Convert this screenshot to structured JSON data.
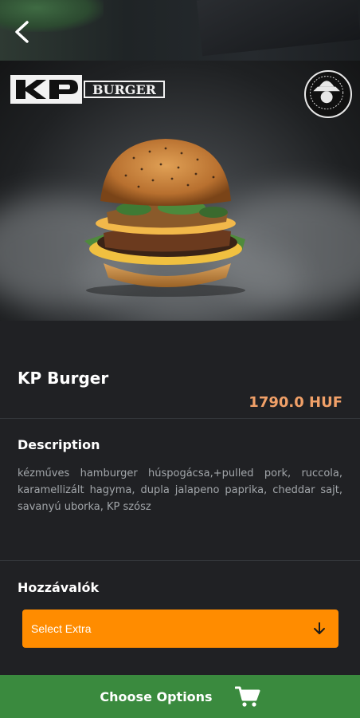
{
  "product": {
    "title": "KP Burger",
    "price": "1790.0 HUF"
  },
  "logo": {
    "brand_text": "BURGER"
  },
  "description": {
    "heading": "Description",
    "text": "kézműves hamburger húspogácsa,+pulled pork, ruccola, karamellizált hagyma, dupla jalapeno paprika, cheddar sajt, savanyú uborka, KP szósz"
  },
  "ingredients": {
    "heading": "Hozzávalók",
    "select_label": "Select Extra"
  },
  "footer": {
    "button_label": "Choose Options"
  },
  "icons": {
    "back": "back-arrow-icon",
    "dropdown": "arrow-down-icon",
    "cart": "cart-icon"
  },
  "colors": {
    "background": "#202124",
    "price": "#f0a068",
    "accent_orange": "#ff8c00",
    "primary_green": "#3a8a3e"
  }
}
